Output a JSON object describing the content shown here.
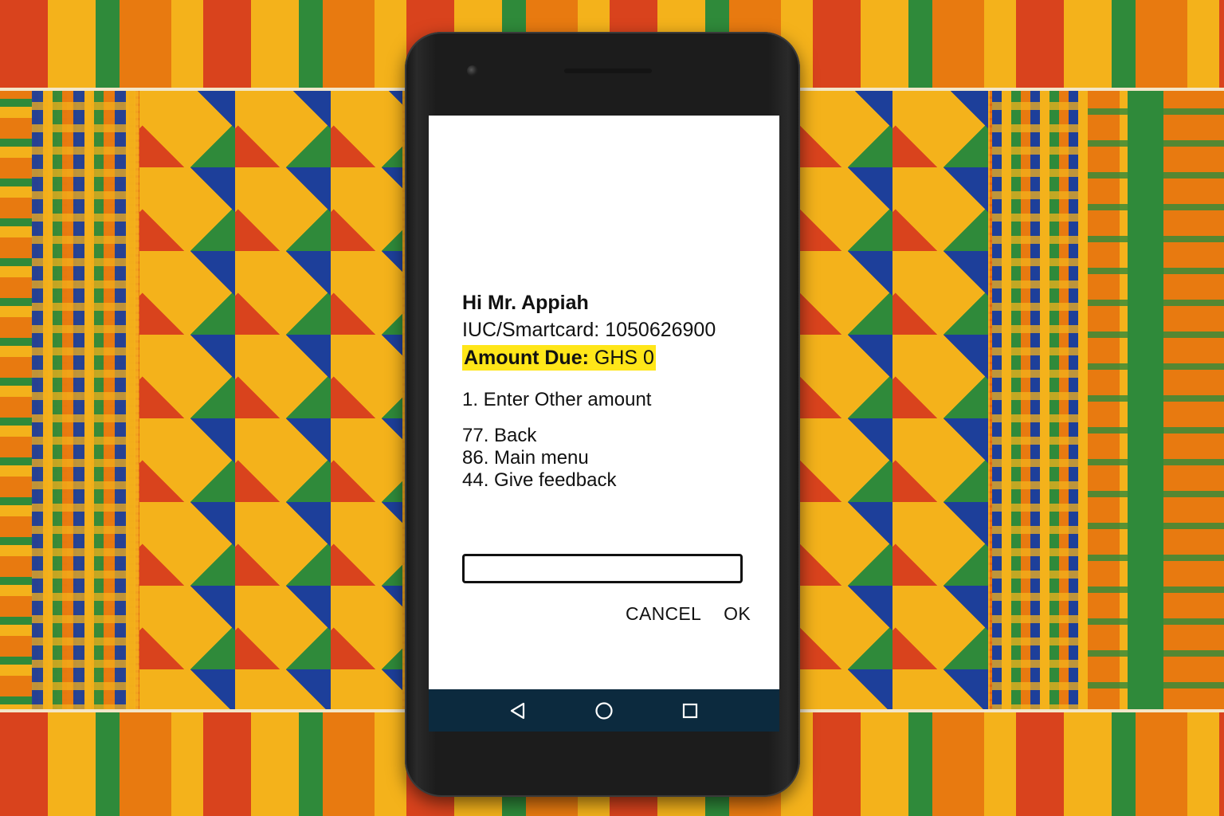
{
  "screen": {
    "greeting": "Hi Mr. Appiah",
    "account_line": "IUC/Smartcard: 1050626900",
    "amount_due_label": "Amount Due:",
    "amount_due_value": "GHS 0",
    "highlight_color": "#ffe619",
    "options": {
      "primary": "1. Enter Other amount",
      "navigation": [
        "77. Back",
        "86. Main menu",
        "44. Give feedback"
      ]
    },
    "input": {
      "value": "",
      "placeholder": ""
    },
    "buttons": {
      "cancel": "CANCEL",
      "ok": "OK"
    }
  },
  "system_nav": {
    "background_color": "#0c2a3e",
    "icons": [
      "back-triangle-icon",
      "home-circle-icon",
      "recents-square-icon"
    ]
  }
}
